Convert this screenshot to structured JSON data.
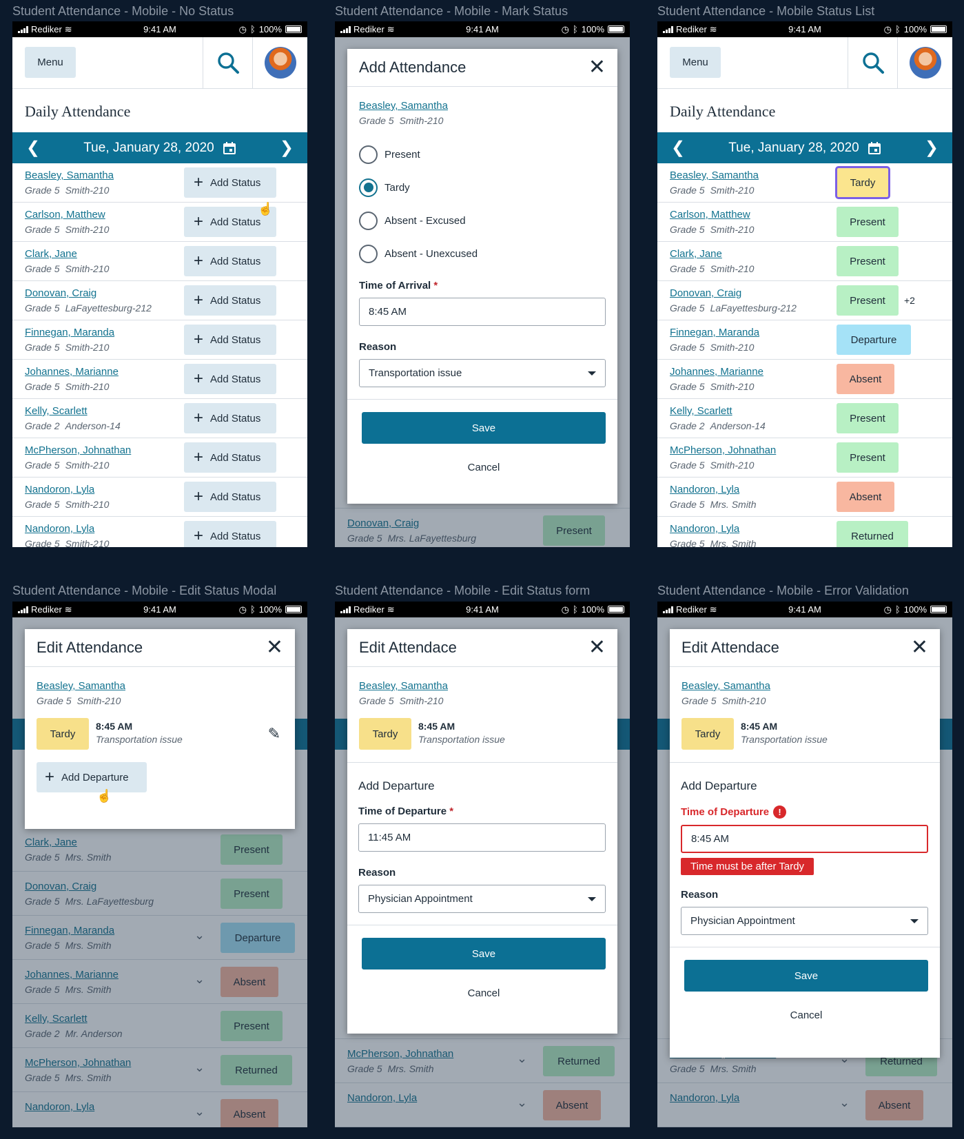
{
  "frame_titles": [
    "Student Attendance - Mobile - No Status",
    "Student Attendance - Mobile - Mark Status",
    "Student Attendance - Mobile Status List",
    "Student Attendance - Mobile - Edit Status Modal",
    "Student Attendance - Mobile - Edit Status form",
    "Student Attendance - Mobile - Error Validation"
  ],
  "status_bar": {
    "carrier": "Rediker",
    "time": "9:41 AM",
    "battery": "100%"
  },
  "app": {
    "menu_label": "Menu",
    "page_title": "Daily Attendance",
    "date": "Tue, January 28, 2020",
    "add_status_label": "Add Status"
  },
  "students_no_status": [
    {
      "name": "Beasley, Samantha",
      "grade": "Grade 5",
      "room": "Smith-210"
    },
    {
      "name": "Carlson, Matthew",
      "grade": "Grade 5",
      "room": "Smith-210"
    },
    {
      "name": "Clark, Jane",
      "grade": "Grade 5",
      "room": "Smith-210"
    },
    {
      "name": "Donovan, Craig",
      "grade": "Grade 5",
      "room": "LaFayettesburg-212"
    },
    {
      "name": "Finnegan, Maranda",
      "grade": "Grade 5",
      "room": "Smith-210"
    },
    {
      "name": "Johannes, Marianne",
      "grade": "Grade 5",
      "room": "Smith-210"
    },
    {
      "name": "Kelly, Scarlett",
      "grade": "Grade 2",
      "room": "Anderson-14"
    },
    {
      "name": "McPherson, Johnathan",
      "grade": "Grade 5",
      "room": "Smith-210"
    },
    {
      "name": "Nandoron, Lyla",
      "grade": "Grade 5",
      "room": "Smith-210"
    },
    {
      "name": "Nandoron, Lyla",
      "grade": "Grade 5",
      "room": "Smith-210"
    }
  ],
  "students_status_list": [
    {
      "name": "Beasley, Samantha",
      "grade": "Grade 5",
      "room": "Smith-210",
      "status": "Tardy"
    },
    {
      "name": "Carlson, Matthew",
      "grade": "Grade 5",
      "room": "Smith-210",
      "status": "Present"
    },
    {
      "name": "Clark, Jane",
      "grade": "Grade 5",
      "room": "Smith-210",
      "status": "Present"
    },
    {
      "name": "Donovan, Craig",
      "grade": "Grade 5",
      "room": "LaFayettesburg-212",
      "status": "Present",
      "extra": "+2"
    },
    {
      "name": "Finnegan, Maranda",
      "grade": "Grade 5",
      "room": "Smith-210",
      "status": "Departure"
    },
    {
      "name": "Johannes, Marianne",
      "grade": "Grade 5",
      "room": "Smith-210",
      "status": "Absent"
    },
    {
      "name": "Kelly, Scarlett",
      "grade": "Grade 2",
      "room": "Anderson-14",
      "status": "Present"
    },
    {
      "name": "McPherson, Johnathan",
      "grade": "Grade 5",
      "room": "Smith-210",
      "status": "Present"
    },
    {
      "name": "Nandoron, Lyla",
      "grade": "Grade 5",
      "room": "Mrs. Smith",
      "status": "Absent"
    },
    {
      "name": "Nandoron, Lyla",
      "grade": "Grade 5",
      "room": "Mrs. Smith",
      "status": "Returned"
    }
  ],
  "students_background": [
    {
      "name": "Clark, Jane",
      "grade": "Grade 5",
      "room": "Mrs. Smith",
      "status": "Present",
      "chev": false
    },
    {
      "name": "Donovan, Craig",
      "grade": "Grade 5",
      "room": "Mrs. LaFayettesburg",
      "status": "Present",
      "chev": false
    },
    {
      "name": "Finnegan, Maranda",
      "grade": "Grade 5",
      "room": "Mrs. Smith",
      "status": "Departure",
      "chev": true
    },
    {
      "name": "Johannes, Marianne",
      "grade": "Grade 5",
      "room": "Mrs. Smith",
      "status": "Absent",
      "chev": true
    },
    {
      "name": "Kelly, Scarlett",
      "grade": "Grade 2",
      "room": "Mr. Anderson",
      "status": "Present",
      "chev": false
    },
    {
      "name": "McPherson, Johnathan",
      "grade": "Grade 5",
      "room": "Mrs. Smith",
      "status": "Returned",
      "chev": true
    },
    {
      "name": "Nandoron, Lyla",
      "grade": "",
      "room": "",
      "status": "Absent",
      "chev": true
    }
  ],
  "bg_tail_mark": [
    {
      "name": "",
      "grade": "Grade 5",
      "room": "Mrs. Smith",
      "status": "Present",
      "chev": false
    },
    {
      "name": "Nandoron, Lyla",
      "grade": "",
      "room": "",
      "status": "Absent",
      "chev": true
    }
  ],
  "bg_tail_edit": [
    {
      "name": "",
      "grade": "Grade 2",
      "room": "Mr. Anderson",
      "status": "Present",
      "chev": false
    },
    {
      "name": "McPherson, Johnathan",
      "grade": "Grade 5",
      "room": "Mrs. Smith",
      "status": "Returned",
      "chev": true
    },
    {
      "name": "Nandoron, Lyla",
      "grade": "",
      "room": "",
      "status": "Absent",
      "chev": true
    }
  ],
  "status_colors": {
    "Tardy": "#fbe58e",
    "Present": "#b8f0c4",
    "Departure": "#a5e2f7",
    "Absent": "#f8b7a0",
    "Returned": "#b8f0c4"
  },
  "modal_student": {
    "name": "Beasley, Samantha",
    "grade": "Grade 5",
    "room": "Smith-210"
  },
  "add_modal": {
    "title": "Add Attendance",
    "options": [
      "Present",
      "Tardy",
      "Absent - Excused",
      "Absent - Unexcused"
    ],
    "selected": "Tardy",
    "time_label": "Time of Arrival",
    "required_mark": "*",
    "time_value": "8:45 AM",
    "reason_label": "Reason",
    "reason_value": "Transportation issue",
    "save": "Save",
    "cancel": "Cancel"
  },
  "edit_modal": {
    "title": "Edit Attendance",
    "status": "Tardy",
    "time": "8:45 AM",
    "reason": "Transportation issue",
    "add_departure": "Add Departure"
  },
  "edit_form": {
    "title": "Edit Attendace",
    "section": "Add Departure",
    "time_label": "Time of Departure",
    "required_mark": "*",
    "time_value": "11:45 AM",
    "reason_label": "Reason",
    "reason_value": "Physician Appointment",
    "save": "Save",
    "cancel": "Cancel"
  },
  "error_form": {
    "title": "Edit Attendace",
    "section": "Add Departure",
    "time_label": "Time of Departure",
    "error_icon": "!",
    "time_value": "8:45 AM",
    "error_message": "Time must be after Tardy",
    "reason_label": "Reason",
    "reason_value": "Physician Appointment",
    "save": "Save",
    "cancel": "Cancel"
  }
}
